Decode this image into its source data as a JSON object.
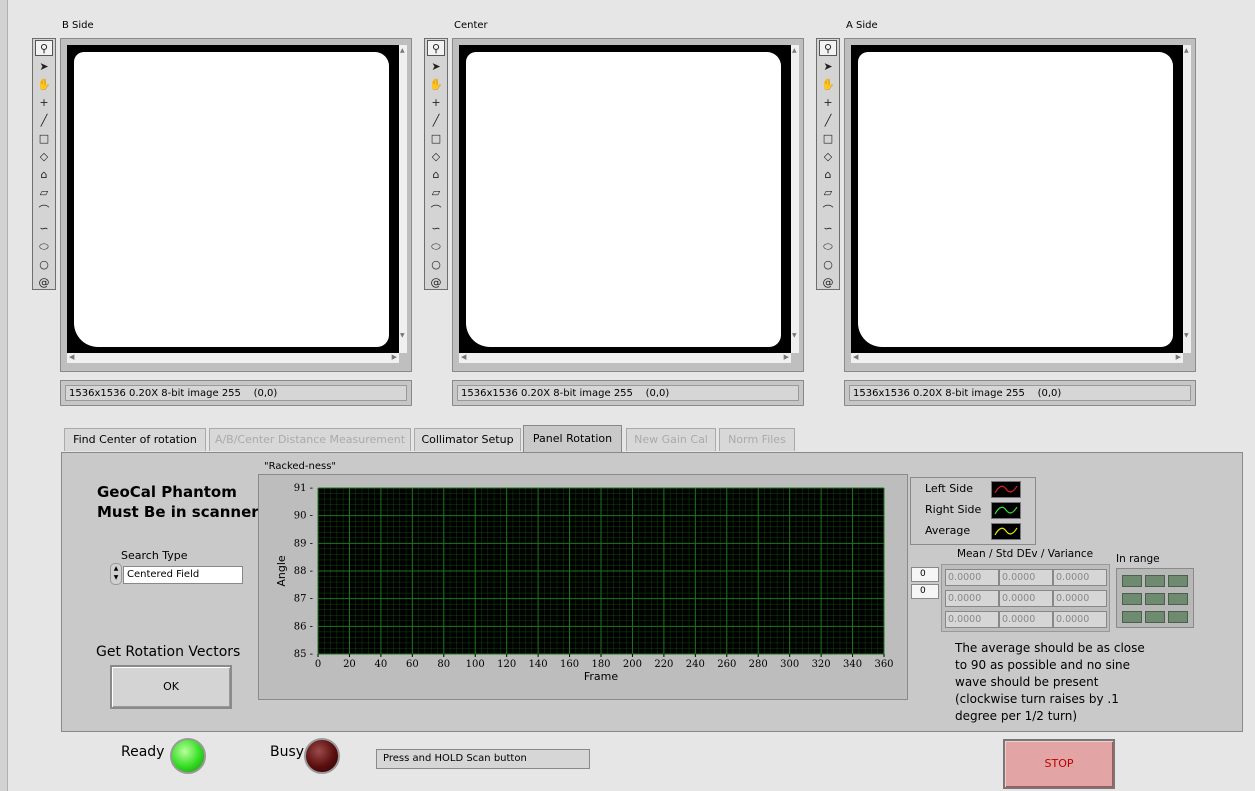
{
  "displays": [
    {
      "title": "B Side",
      "status": "1536x1536 0.20X 8-bit image 255    (0,0)"
    },
    {
      "title": "Center",
      "status": "1536x1536 0.20X 8-bit image 255    (0,0)"
    },
    {
      "title": "A Side",
      "status": "1536x1536 0.20X 8-bit image 255    (0,0)"
    }
  ],
  "toolbar_icons": [
    "zoom-icon",
    "pointer-icon",
    "pan-hand-icon",
    "point-icon",
    "line-icon",
    "rectangle-icon",
    "rotated-rectangle-icon",
    "polygon-icon",
    "freehand-icon",
    "annulus-icon",
    "broken-line-icon",
    "oval-icon",
    "circle-icon",
    "spiral-icon"
  ],
  "tabs": [
    {
      "label": "Find Center of rotation",
      "state": "enabled"
    },
    {
      "label": "A/B/Center Distance Measurement",
      "state": "disabled"
    },
    {
      "label": "Collimator Setup",
      "state": "enabled"
    },
    {
      "label": "Panel Rotation",
      "state": "active"
    },
    {
      "label": "New Gain Cal",
      "state": "disabled"
    },
    {
      "label": "Norm Files",
      "state": "disabled"
    }
  ],
  "panel": {
    "phantom_line1": "GeoCal Phantom",
    "phantom_line2": "Must Be in scanner",
    "search_type_label": "Search Type",
    "search_type_value": "Centered Field",
    "get_vectors_label": "Get Rotation Vectors",
    "ok_label": "OK"
  },
  "chart_data": {
    "type": "line",
    "title": "\"Racked-ness\"",
    "xlabel": "Frame",
    "ylabel": "Angle",
    "xlim": [
      0,
      360
    ],
    "ylim": [
      85,
      91
    ],
    "xticks": [
      0,
      20,
      40,
      60,
      80,
      100,
      120,
      140,
      160,
      180,
      200,
      220,
      240,
      260,
      280,
      300,
      320,
      340,
      360
    ],
    "yticks": [
      85,
      86,
      87,
      88,
      89,
      90,
      91
    ],
    "grid": true,
    "background": "#000000",
    "grid_color": "#1a7a1a",
    "series": [
      {
        "name": "Left Side",
        "color": "#e02020",
        "values": []
      },
      {
        "name": "Right Side",
        "color": "#30e030",
        "values": []
      },
      {
        "name": "Average",
        "color": "#e8e800",
        "values": []
      }
    ]
  },
  "legend": {
    "items": [
      "Left Side",
      "Right Side",
      "Average"
    ]
  },
  "stats": {
    "title": "Mean / Std DEv / Variance",
    "index1": "0",
    "index2": "0",
    "rows": [
      [
        "0.0000",
        "0.0000",
        "0.0000"
      ],
      [
        "0.0000",
        "0.0000",
        "0.0000"
      ],
      [
        "0.0000",
        "0.0000",
        "0.0000"
      ]
    ],
    "in_range_label": "In range"
  },
  "note": "The average should be as close to 90 as possible and no sine wave should be present (clockwise turn raises by .1 degree per 1/2 turn)",
  "bottom": {
    "ready_label": "Ready",
    "ready_color": "#33dd22",
    "busy_label": "Busy",
    "busy_color": "#5a0e0e",
    "message": "Press and HOLD Scan button",
    "stop_label": "STOP"
  }
}
